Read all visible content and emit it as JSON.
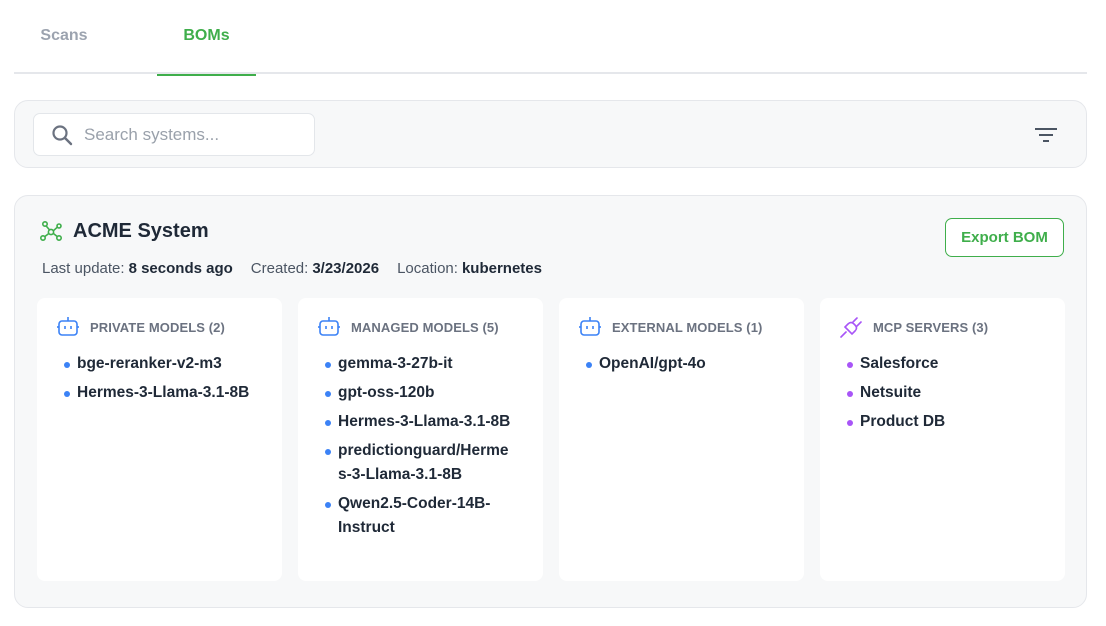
{
  "tabs": [
    {
      "label": "Scans",
      "active": false
    },
    {
      "label": "BOMs",
      "active": true
    }
  ],
  "search": {
    "placeholder": "Search systems...",
    "value": ""
  },
  "system": {
    "name": "ACME System",
    "export_label": "Export BOM",
    "meta": {
      "last_update_label": "Last update:",
      "last_update_value": "8 seconds ago",
      "created_label": "Created:",
      "created_value": "3/23/2026",
      "location_label": "Location:",
      "location_value": "kubernetes"
    },
    "columns": [
      {
        "title": "PRIVATE MODELS (2)",
        "icon": "robot-icon",
        "items": [
          "bge-reranker-v2-m3",
          "Hermes-3-Llama-3.1-8B"
        ]
      },
      {
        "title": "MANAGED MODELS (5)",
        "icon": "robot-icon",
        "items": [
          "gemma-3-27b-it",
          "gpt-oss-120b",
          "Hermes-3-Llama-3.1-8B",
          "predictionguard/Hermes-3-Llama-3.1-8B",
          "Qwen2.5-Coder-14B-Instruct"
        ]
      },
      {
        "title": "EXTERNAL MODELS (1)",
        "icon": "robot-icon",
        "items": [
          "OpenAI/gpt-4o"
        ]
      },
      {
        "title": "MCP SERVERS (3)",
        "icon": "plug-icon",
        "items": [
          "Salesforce",
          "Netsuite",
          "Product DB"
        ]
      }
    ]
  },
  "colors": {
    "accent": "#3fae4b",
    "model_icon": "#3b82f6",
    "mcp_icon": "#a855f7",
    "bullet_model": "#3b82f6",
    "bullet_mcp": "#a855f7"
  }
}
